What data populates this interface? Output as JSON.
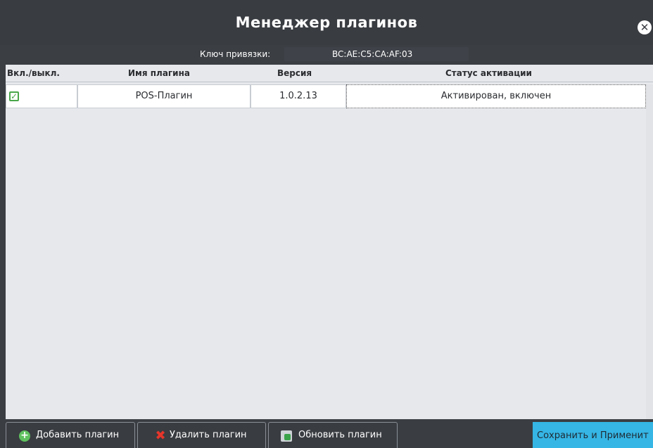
{
  "dialog": {
    "title": "Менеджер плагинов",
    "close_icon": "close-icon"
  },
  "binding_key": {
    "label": "Ключ привязки:",
    "value": "BC:AE:C5:CA:AF:03"
  },
  "table": {
    "columns": [
      "Вкл./выкл.",
      "Имя плагина",
      "Версия",
      "Статус активации"
    ],
    "rows": [
      {
        "enabled": true,
        "name": "POS-Плагин",
        "version": "1.0.2.13",
        "status": "Активирован, включен"
      }
    ]
  },
  "buttons": {
    "add": {
      "label": "Добавить плагин",
      "icon": "plus-circle-icon"
    },
    "delete": {
      "label": "Удалить плагин",
      "icon": "x-icon"
    },
    "update": {
      "label": "Обновить плагин",
      "icon": "refresh-icon"
    },
    "save": {
      "label": "Сохранить и Применит",
      "color": "#35b6e5"
    }
  },
  "colors": {
    "background": "#3b3e43",
    "table": "#e6e8ec",
    "accent": "#35b6e5"
  }
}
